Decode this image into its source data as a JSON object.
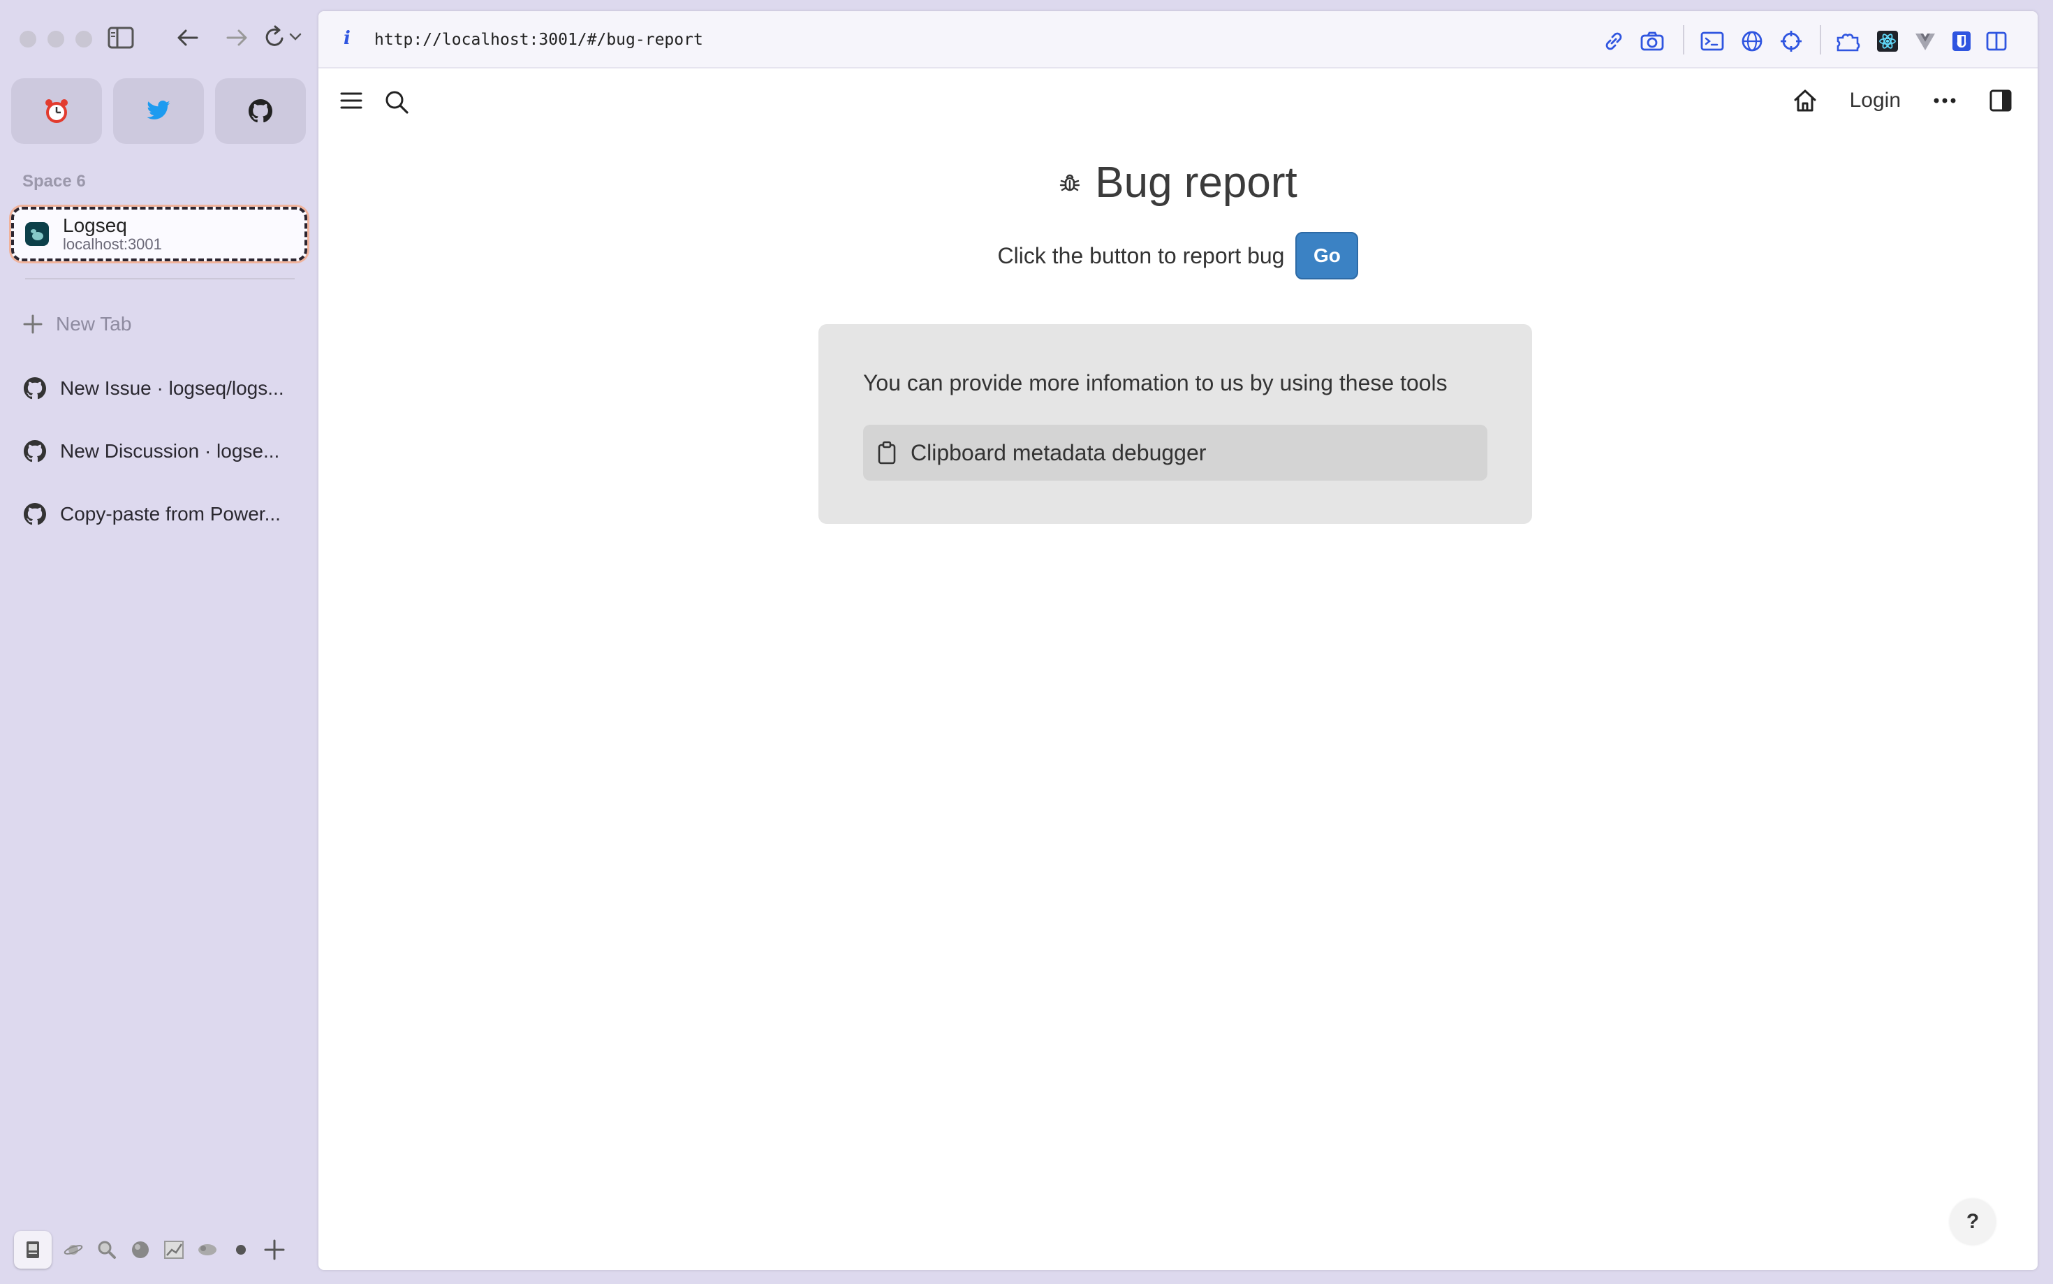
{
  "browser": {
    "url": "http://localhost:3001/#/bug-report",
    "url_info_glyph": "i"
  },
  "sidebar": {
    "pinned": [
      {
        "icon": "alarm-clock-icon"
      },
      {
        "icon": "twitter-icon"
      },
      {
        "icon": "github-icon"
      }
    ],
    "space_label": "Space 6",
    "active_tab": {
      "title": "Logseq",
      "subtitle": "localhost:3001"
    },
    "new_tab_label": "New Tab",
    "tabs": [
      {
        "title": "New Issue · logseq/logs..."
      },
      {
        "title": "New Discussion · logse..."
      },
      {
        "title": "Copy-paste from Power..."
      }
    ]
  },
  "app": {
    "login_label": "Login",
    "title": "Bug report",
    "report_prompt": "Click the button to report bug",
    "go_label": "Go",
    "tools_description": "You can provide more infomation to us by using these tools",
    "tools": [
      {
        "label": "Clipboard metadata debugger",
        "icon": "clipboard-icon"
      }
    ],
    "help_label": "?"
  },
  "colors": {
    "sidebar_bg": "#ddd9ee",
    "accent_blue": "#3b82c4",
    "tools_box": "#e5e5e5",
    "extension_blue": "#2f55e0"
  }
}
